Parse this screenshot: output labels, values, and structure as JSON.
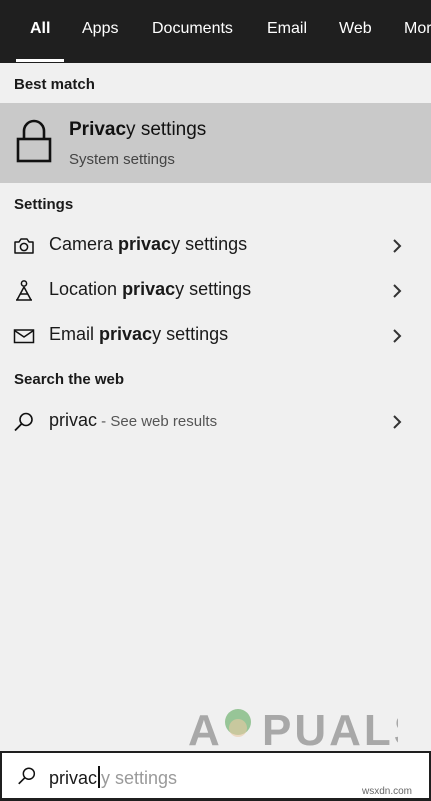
{
  "tabs": [
    {
      "label": "All",
      "active": true
    },
    {
      "label": "Apps"
    },
    {
      "label": "Documents"
    },
    {
      "label": "Email"
    },
    {
      "label": "Web"
    },
    {
      "label": "More"
    }
  ],
  "best_match": {
    "header": "Best match",
    "title_bold": "Privac",
    "title_rest": "y settings",
    "subtitle": "System settings",
    "icon": "lock-icon"
  },
  "settings": {
    "header": "Settings",
    "items": [
      {
        "pre": "Camera ",
        "bold": "privac",
        "post": "y settings",
        "icon": "camera-icon"
      },
      {
        "pre": "Location ",
        "bold": "privac",
        "post": "y settings",
        "icon": "location-person-icon"
      },
      {
        "pre": "Email ",
        "bold": "privac",
        "post": "y settings",
        "icon": "envelope-icon"
      }
    ]
  },
  "web": {
    "header": "Search the web",
    "query": "privac",
    "suffix": " - See web results",
    "icon": "search-icon"
  },
  "search": {
    "typed": "privac",
    "ghost": "y settings"
  },
  "watermark": {
    "text": "APPUALS"
  },
  "credit": "wsxdn.com",
  "colors": {
    "tabbar_bg": "#1f1f1f",
    "panel_bg": "#f0f0f0",
    "highlight_bg": "#c9c9c9"
  }
}
